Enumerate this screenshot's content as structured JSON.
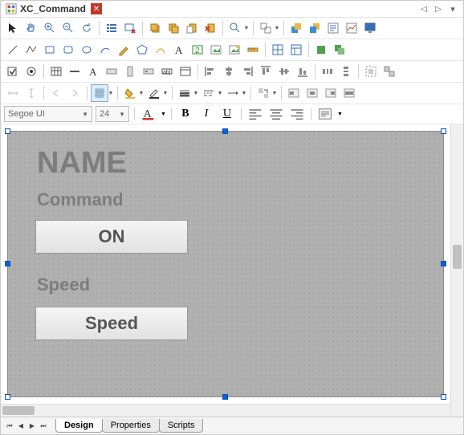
{
  "titlebar": {
    "title": "XC_Command"
  },
  "fontbar": {
    "font_name": "Segoe UI",
    "font_size": "24"
  },
  "canvas": {
    "name_label": "NAME",
    "command_label": "Command",
    "on_button": "ON",
    "speed_label": "Speed",
    "speed_button": "Speed"
  },
  "tabs": {
    "design": "Design",
    "properties": "Properties",
    "scripts": "Scripts"
  }
}
